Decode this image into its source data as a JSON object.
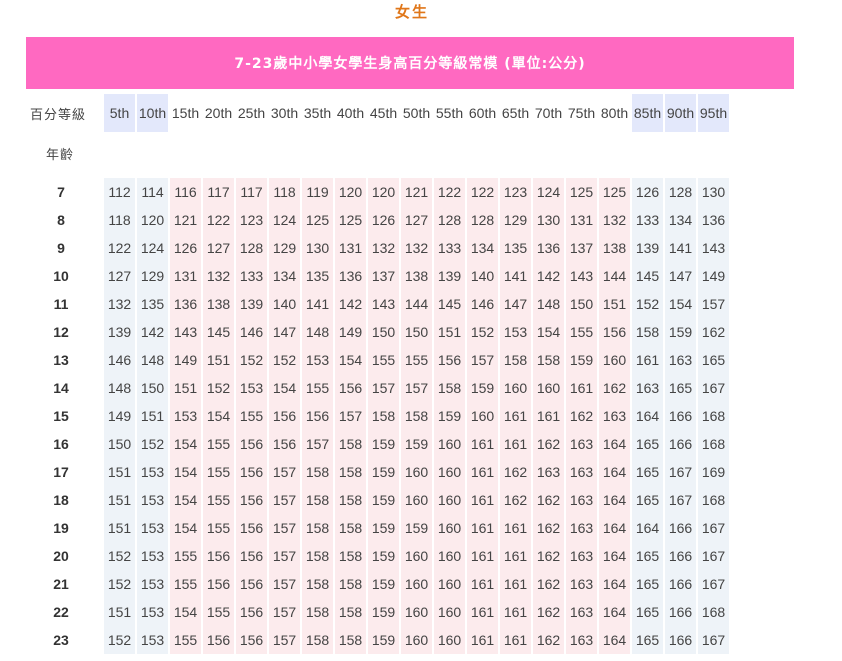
{
  "gender_title": "女生",
  "banner_title": "7-23歲中小學女學生身高百分等級常模 (單位:公分)",
  "header": {
    "percentile_label": "百分等級",
    "age_label": "年齡",
    "percentiles": [
      "5th",
      "10th",
      "15th",
      "20th",
      "25th",
      "30th",
      "35th",
      "40th",
      "45th",
      "50th",
      "55th",
      "60th",
      "65th",
      "70th",
      "75th",
      "80th",
      "85th",
      "90th",
      "95th"
    ]
  },
  "colors": {
    "banner_bg": "#ff69c1",
    "gender_title": "#e0771a",
    "outer_columns_bg": "#eef3f8",
    "middle_columns_bg": "#fcebed",
    "header_highlight": "#e3e8fb"
  },
  "rows": [
    {
      "age": "7",
      "values": [
        "112",
        "114",
        "116",
        "117",
        "117",
        "118",
        "119",
        "120",
        "120",
        "121",
        "122",
        "122",
        "123",
        "124",
        "125",
        "125",
        "126",
        "128",
        "130"
      ]
    },
    {
      "age": "8",
      "values": [
        "118",
        "120",
        "121",
        "122",
        "123",
        "124",
        "125",
        "125",
        "126",
        "127",
        "128",
        "128",
        "129",
        "130",
        "131",
        "132",
        "133",
        "134",
        "136"
      ]
    },
    {
      "age": "9",
      "values": [
        "122",
        "124",
        "126",
        "127",
        "128",
        "129",
        "130",
        "131",
        "132",
        "132",
        "133",
        "134",
        "135",
        "136",
        "137",
        "138",
        "139",
        "141",
        "143"
      ]
    },
    {
      "age": "10",
      "values": [
        "127",
        "129",
        "131",
        "132",
        "133",
        "134",
        "135",
        "136",
        "137",
        "138",
        "139",
        "140",
        "141",
        "142",
        "143",
        "144",
        "145",
        "147",
        "149"
      ]
    },
    {
      "age": "11",
      "values": [
        "132",
        "135",
        "136",
        "138",
        "139",
        "140",
        "141",
        "142",
        "143",
        "144",
        "145",
        "146",
        "147",
        "148",
        "150",
        "151",
        "152",
        "154",
        "157"
      ]
    },
    {
      "age": "12",
      "values": [
        "139",
        "142",
        "143",
        "145",
        "146",
        "147",
        "148",
        "149",
        "150",
        "150",
        "151",
        "152",
        "153",
        "154",
        "155",
        "156",
        "158",
        "159",
        "162"
      ]
    },
    {
      "age": "13",
      "values": [
        "146",
        "148",
        "149",
        "151",
        "152",
        "152",
        "153",
        "154",
        "155",
        "155",
        "156",
        "157",
        "158",
        "158",
        "159",
        "160",
        "161",
        "163",
        "165"
      ]
    },
    {
      "age": "14",
      "values": [
        "148",
        "150",
        "151",
        "152",
        "153",
        "154",
        "155",
        "156",
        "157",
        "157",
        "158",
        "159",
        "160",
        "160",
        "161",
        "162",
        "163",
        "165",
        "167"
      ]
    },
    {
      "age": "15",
      "values": [
        "149",
        "151",
        "153",
        "154",
        "155",
        "156",
        "156",
        "157",
        "158",
        "158",
        "159",
        "160",
        "161",
        "161",
        "162",
        "163",
        "164",
        "166",
        "168"
      ]
    },
    {
      "age": "16",
      "values": [
        "150",
        "152",
        "154",
        "155",
        "156",
        "156",
        "157",
        "158",
        "159",
        "159",
        "160",
        "161",
        "161",
        "162",
        "163",
        "164",
        "165",
        "166",
        "168"
      ]
    },
    {
      "age": "17",
      "values": [
        "151",
        "153",
        "154",
        "155",
        "156",
        "157",
        "158",
        "158",
        "159",
        "160",
        "160",
        "161",
        "162",
        "163",
        "163",
        "164",
        "165",
        "167",
        "169"
      ]
    },
    {
      "age": "18",
      "values": [
        "151",
        "153",
        "154",
        "155",
        "156",
        "157",
        "158",
        "158",
        "159",
        "160",
        "160",
        "161",
        "162",
        "162",
        "163",
        "164",
        "165",
        "167",
        "168"
      ]
    },
    {
      "age": "19",
      "values": [
        "151",
        "153",
        "154",
        "155",
        "156",
        "157",
        "158",
        "158",
        "159",
        "159",
        "160",
        "161",
        "161",
        "162",
        "163",
        "164",
        "164",
        "166",
        "167"
      ]
    },
    {
      "age": "20",
      "values": [
        "152",
        "153",
        "155",
        "156",
        "156",
        "157",
        "158",
        "158",
        "159",
        "160",
        "160",
        "161",
        "161",
        "162",
        "163",
        "164",
        "165",
        "166",
        "167"
      ]
    },
    {
      "age": "21",
      "values": [
        "152",
        "153",
        "155",
        "156",
        "156",
        "157",
        "158",
        "158",
        "159",
        "160",
        "160",
        "161",
        "161",
        "162",
        "163",
        "164",
        "165",
        "166",
        "167"
      ]
    },
    {
      "age": "22",
      "values": [
        "151",
        "153",
        "154",
        "155",
        "156",
        "157",
        "158",
        "158",
        "159",
        "160",
        "160",
        "161",
        "161",
        "162",
        "163",
        "164",
        "165",
        "166",
        "168"
      ]
    },
    {
      "age": "23",
      "values": [
        "152",
        "153",
        "155",
        "156",
        "156",
        "157",
        "158",
        "158",
        "159",
        "160",
        "160",
        "161",
        "161",
        "162",
        "163",
        "164",
        "165",
        "166",
        "167"
      ]
    }
  ]
}
